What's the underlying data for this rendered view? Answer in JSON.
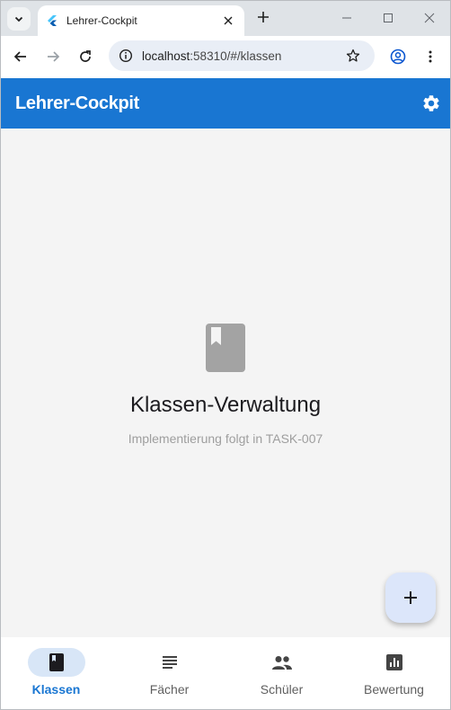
{
  "browser": {
    "tab_title": "Lehrer-Cockpit",
    "url_host": "localhost",
    "url_path": ":58310/#/klassen"
  },
  "appbar": {
    "title": "Lehrer-Cockpit",
    "settings_icon": "gear-icon"
  },
  "empty_state": {
    "icon": "book-icon",
    "title": "Klassen-Verwaltung",
    "subtitle": "Implementierung folgt in TASK-007"
  },
  "fab": {
    "icon": "plus-icon"
  },
  "bottom_nav": {
    "items": [
      {
        "label": "Klassen",
        "icon": "book-icon",
        "active": true
      },
      {
        "label": "Fächer",
        "icon": "lines-icon",
        "active": false
      },
      {
        "label": "Schüler",
        "icon": "people-icon",
        "active": false
      },
      {
        "label": "Bewertung",
        "icon": "bar-chart-icon",
        "active": false
      }
    ]
  },
  "colors": {
    "primary": "#1976d2",
    "background": "#f4f4f4",
    "fab": "#dce6fa",
    "nav_indicator": "#d8e6f7"
  }
}
